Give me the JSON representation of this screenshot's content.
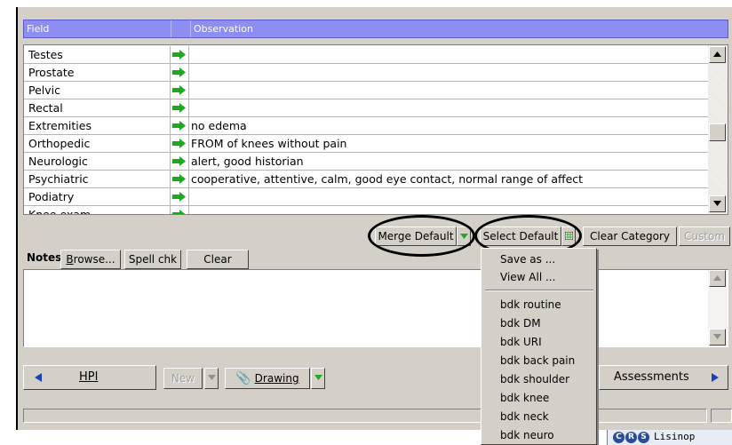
{
  "header": {
    "field_label": "Field",
    "observation_label": "Observation"
  },
  "rows": [
    {
      "field": "Testes",
      "observation": ""
    },
    {
      "field": "Prostate",
      "observation": ""
    },
    {
      "field": "Pelvic",
      "observation": ""
    },
    {
      "field": "Rectal",
      "observation": ""
    },
    {
      "field": "Extremities",
      "observation": "no edema"
    },
    {
      "field": "Orthopedic",
      "observation": "FROM of knees without pain"
    },
    {
      "field": "Neurologic",
      "observation": "alert, good historian"
    },
    {
      "field": "Psychiatric",
      "observation": "cooperative, attentive, calm, good eye contact, normal range of affect"
    },
    {
      "field": "Podiatry",
      "observation": ""
    },
    {
      "field": "Knee exam",
      "observation": ""
    }
  ],
  "actions": {
    "merge_default": "Merge Default",
    "select_default": "Select Default",
    "clear_category": "Clear Category",
    "custom": "Custom"
  },
  "notes": {
    "label": "Notes",
    "browse": "Browse...",
    "spell_check": "Spell chk",
    "clear": "Clear"
  },
  "nav": {
    "hpi": "HPI",
    "new": "New",
    "drawing": "Drawing",
    "assessments": "Assessments"
  },
  "dropdown": {
    "top_items": [
      "Save as ...",
      "View All ..."
    ],
    "defaults": [
      "bdk routine",
      "bdk DM",
      "bdk URI",
      "bdk back pain",
      "bdk shoulder",
      "bdk knee",
      "bdk neck",
      "bdk neuro"
    ]
  },
  "taskbar": {
    "crs_letters": [
      "C",
      "R",
      "S"
    ],
    "label": "Lisinop"
  },
  "colors": {
    "header_bg": "#8d8df4",
    "arrow_green": "#1fa81f",
    "window_bg": "#d4d0c8"
  }
}
